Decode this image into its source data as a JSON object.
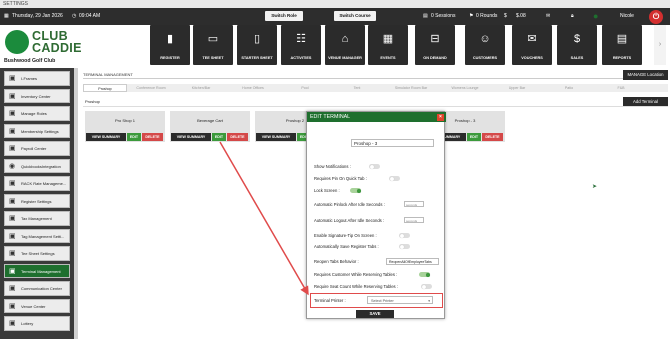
{
  "window": {
    "title": "SETTINGS"
  },
  "topbar": {
    "date": "Thursday, 29 Jan 2026",
    "time": "09:04 AM",
    "switch_role": "Switch Role",
    "switch_course": "Switch Course",
    "sessions": "0 Sessions",
    "rounds": "0 Rounds",
    "amount": "$.08",
    "user": "Nicole"
  },
  "brand": {
    "line1": "CLUB",
    "line2": "CADDIE",
    "club_name": "Bushwood Golf Club",
    "accent_color": "#1e6f2e"
  },
  "nav": [
    {
      "label": "REGISTER",
      "icon": "register-icon"
    },
    {
      "label": "TEE SHEET",
      "icon": "tee-sheet-icon"
    },
    {
      "label": "STARTER SHEET",
      "icon": "starter-sheet-icon"
    },
    {
      "label": "ACTIVITIES",
      "icon": "activities-icon"
    },
    {
      "label": "VENUE MANAGER",
      "icon": "venue-manager-icon"
    },
    {
      "label": "EVENTS",
      "icon": "events-icon"
    },
    {
      "label": "ON DEMAND",
      "icon": "on-demand-icon"
    },
    {
      "label": "CUSTOMERS",
      "icon": "customers-icon"
    },
    {
      "label": "VOUCHERS",
      "icon": "vouchers-icon"
    },
    {
      "label": "SALES",
      "icon": "sales-icon"
    },
    {
      "label": "REPORTS",
      "icon": "reports-icon"
    }
  ],
  "sidebar": {
    "items": [
      {
        "label": "I-Frames"
      },
      {
        "label": "Inventory Center"
      },
      {
        "label": "Manage Roles"
      },
      {
        "label": "Membership Settings"
      },
      {
        "label": "Payroll Center"
      },
      {
        "label": "QuickbooksIntegration"
      },
      {
        "label": "RACK Rate Manageme..."
      },
      {
        "label": "Register Settings"
      },
      {
        "label": "Tax Management"
      },
      {
        "label": "Tag Management Setti..."
      },
      {
        "label": "Tee Sheet Settings"
      },
      {
        "label": "Terminal Management"
      },
      {
        "label": "Communication Center"
      },
      {
        "label": "Venue Center"
      },
      {
        "label": "Lottery"
      }
    ]
  },
  "main": {
    "section_title": "TERMINAL MANAGEMENT",
    "manage_location": "MANAGE Location",
    "add_terminal": "Add Terminal",
    "current_location": "Proshop",
    "location_tabs": [
      "Proshop",
      "Conference Room",
      "Kitchen/Bar",
      "Home Offices",
      "Pool",
      "Tent",
      "Simulator Room Bar",
      "Womens Lounge",
      "Upper Bar",
      "Patio",
      "F&B"
    ],
    "terminals": [
      {
        "name": "Pro Shop 1"
      },
      {
        "name": "Beverage Cart"
      },
      {
        "name": "Proshop 2"
      },
      {
        "name": "Proshop - 3"
      }
    ],
    "card_buttons": {
      "summary": "VIEW SUMMARY",
      "edit": "EDIT",
      "delete": "DELETE"
    }
  },
  "modal": {
    "title": "EDIT TERMINAL",
    "name_value": "Proshop - 3",
    "show_notifications": "Show Notifications :",
    "requires_pin": "Requires Pin On Quick Tab :",
    "lock_screen": "Lock Screen :",
    "auto_pinlock": "Automatic Pinlock After Idle Seconds :",
    "auto_logout": "Automatic Logout After Idle Seconds :",
    "seconds_placeholder": "seconds",
    "signature_tip": "Enable Signature-Tip On Screen :",
    "auto_save_tabs": "Automatically Save Register Tabs :",
    "reopen_tabs": "Reopen Tabs Behavior :",
    "reopen_tabs_value": "ReopenAllOfEmployeeTabs",
    "requires_customer": "Requires Customer While Reserving Tables :",
    "require_seat_count": "Require Seat Count While Reserving Tables :",
    "terminal_printer": "Terminal Printer :",
    "printer_value": "Select Printer",
    "save": "SAVE"
  }
}
